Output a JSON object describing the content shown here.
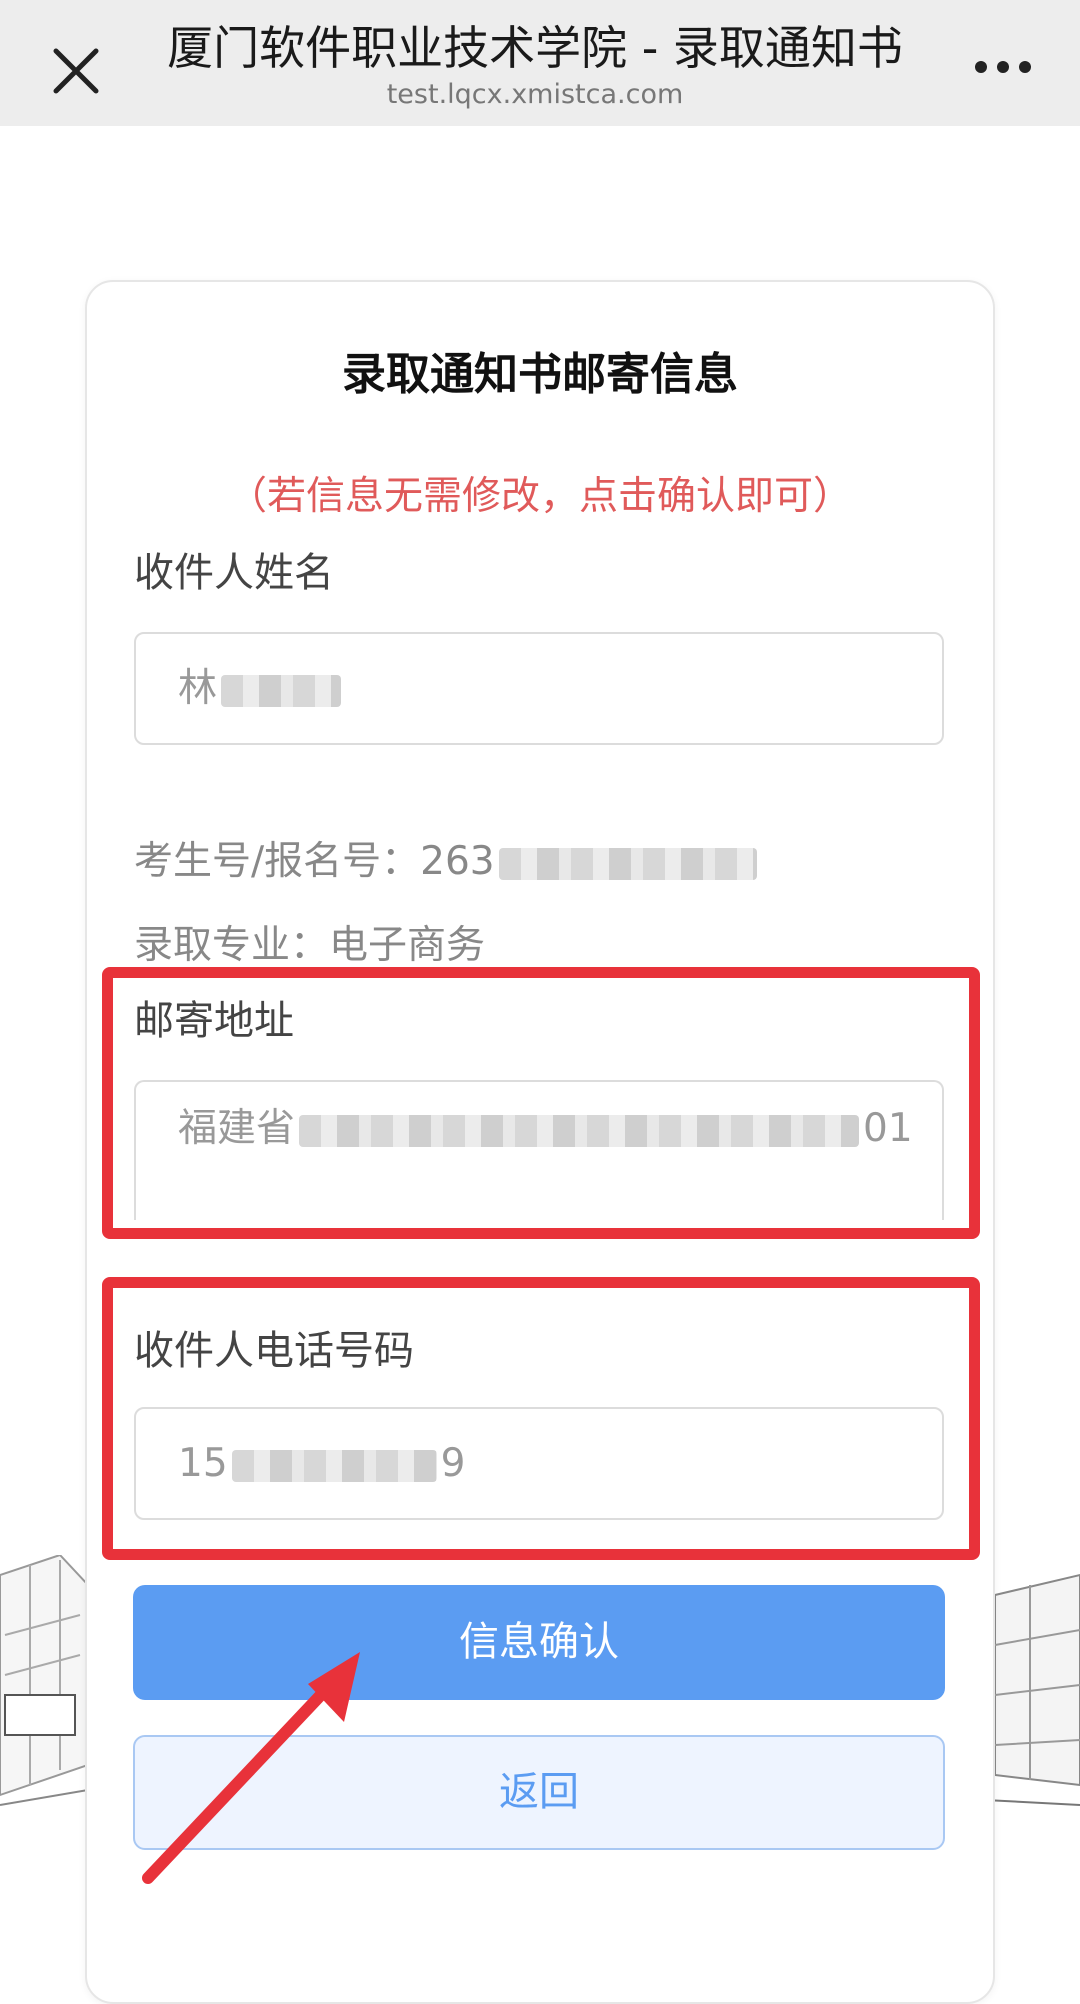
{
  "window": {
    "title": "厦门软件职业技术学院 - 录取通知书",
    "url": "test.lqcx.xmistca.com",
    "close_icon": "close-icon",
    "more_icon": "more-icon"
  },
  "form": {
    "title": "录取通知书邮寄信息",
    "hint": "（若信息无需修改，点击确认即可）",
    "name_label": "收件人姓名",
    "name_value": "林",
    "exam_label": "考生号/报名号：",
    "exam_value": "263",
    "major_label": "录取专业：",
    "major_value": "电子商务",
    "address_label": "邮寄地址",
    "address_value_start": "福建省",
    "address_value_end": "01",
    "phone_label": "收件人电话号码",
    "phone_value_start": "15",
    "phone_value_end": "9",
    "confirm_label": "信息确认",
    "back_label": "返回"
  },
  "colors": {
    "accent": "#5b9cf2",
    "hint": "#e05a5a",
    "highlight": "#e8323a"
  }
}
